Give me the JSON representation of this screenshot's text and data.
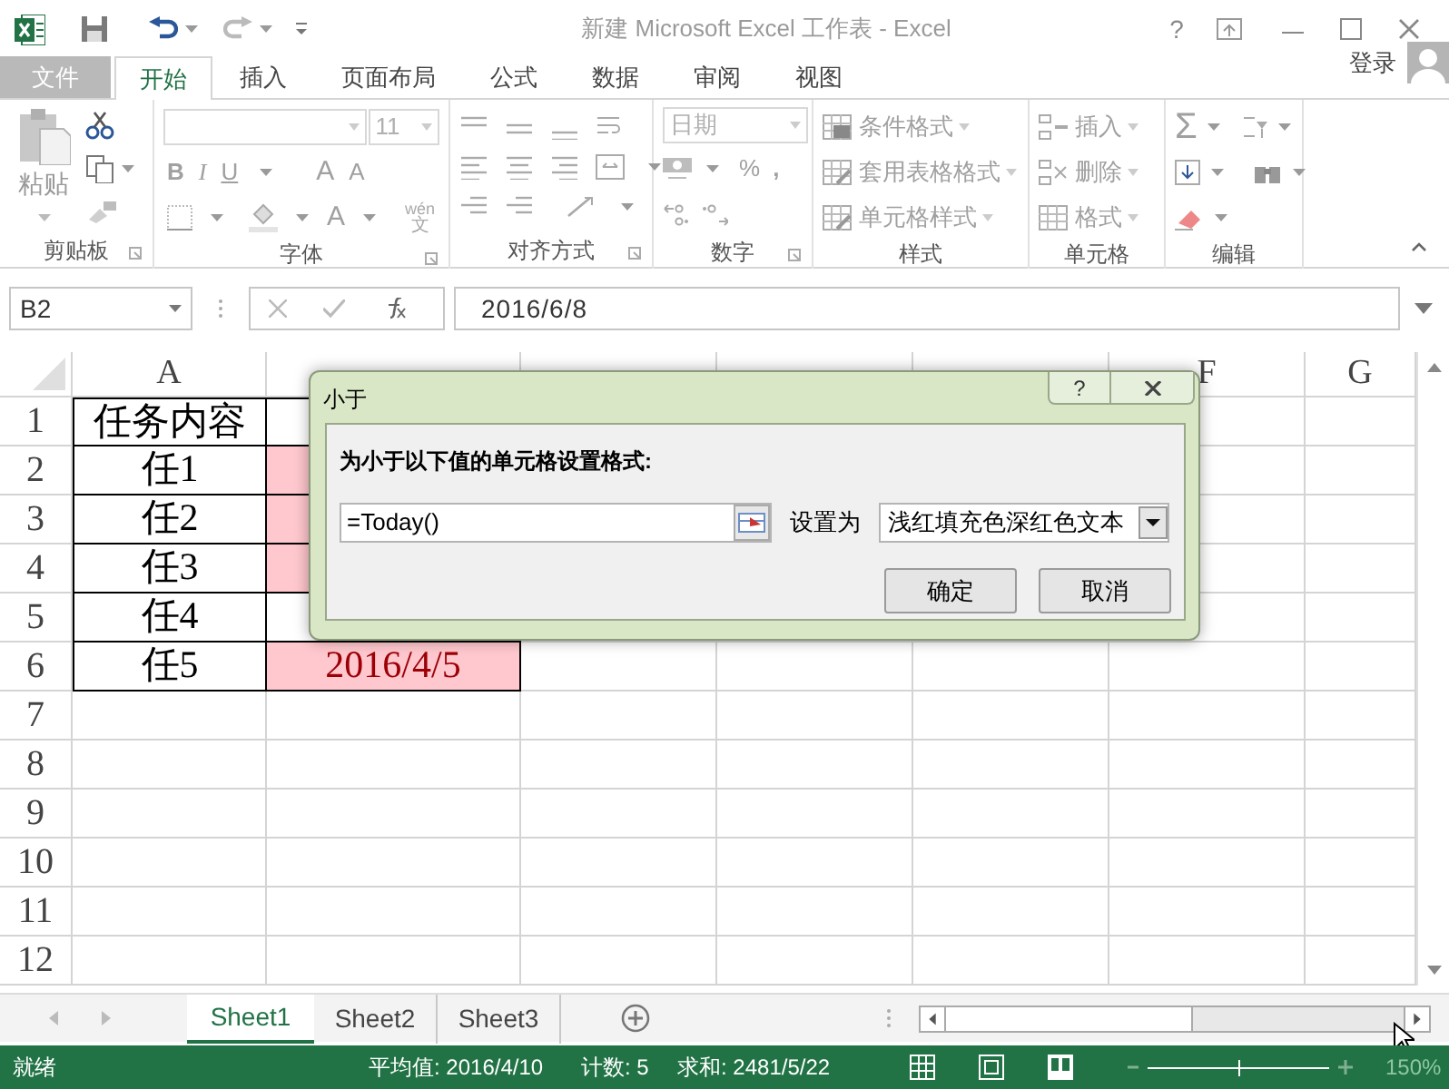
{
  "title_bar": {
    "title": "新建 Microsoft Excel 工作表 - Excel",
    "help": "?"
  },
  "ribbon_tabs": [
    {
      "label": "文件",
      "kind": "file",
      "selected": false
    },
    {
      "label": "开始",
      "kind": "tab",
      "selected": true
    },
    {
      "label": "插入",
      "kind": "tab",
      "selected": false
    },
    {
      "label": "页面布局",
      "kind": "tab",
      "selected": false
    },
    {
      "label": "公式",
      "kind": "tab",
      "selected": false
    },
    {
      "label": "数据",
      "kind": "tab",
      "selected": false
    },
    {
      "label": "审阅",
      "kind": "tab",
      "selected": false
    },
    {
      "label": "视图",
      "kind": "tab",
      "selected": false
    }
  ],
  "account": {
    "label": "登录"
  },
  "ribbon": {
    "paste": "粘贴",
    "font_size": "11",
    "bold": "B",
    "italic": "I",
    "underline": "U",
    "grow_font": "A",
    "shrink_font": "A",
    "font_color": "A",
    "phonetic_top": "wén",
    "phonetic_bottom": "文",
    "number_format": "日期",
    "percent": "%",
    "comma": ",",
    "conditional_format": "条件格式",
    "table_format": "套用表格格式",
    "cell_styles": "单元格样式",
    "insert": "插入",
    "delete": "删除",
    "format": "格式",
    "autosum": "Σ",
    "groups": [
      "剪贴板",
      "字体",
      "对齐方式",
      "数字",
      "样式",
      "单元格",
      "编辑"
    ]
  },
  "formula_bar": {
    "name_box": "B2",
    "formula": "2016/6/8"
  },
  "columns": [
    {
      "label": "A"
    },
    {},
    {},
    {},
    {},
    {
      "label": "F"
    },
    {
      "label": "G"
    }
  ],
  "rows": [
    {
      "header": "1",
      "cells": [
        {
          "text": "任务内容",
          "highlight": false
        },
        {
          "highlight": false
        }
      ]
    },
    {
      "header": "2",
      "cells": [
        {
          "text": "任1",
          "highlight": false
        },
        {
          "highlight": true
        }
      ]
    },
    {
      "header": "3",
      "cells": [
        {
          "text": "任2",
          "highlight": false
        },
        {
          "highlight": true
        }
      ]
    },
    {
      "header": "4",
      "cells": [
        {
          "text": "任3",
          "highlight": false
        },
        {
          "highlight": true
        }
      ]
    },
    {
      "header": "5",
      "cells": [
        {
          "text": "任4",
          "highlight": false
        },
        {
          "highlight": false
        }
      ]
    },
    {
      "header": "6",
      "cells": [
        {
          "text": "任5",
          "highlight": false
        },
        {
          "text": "2016/4/5",
          "highlight": true
        }
      ]
    },
    {
      "header": "7"
    },
    {
      "header": "8"
    },
    {
      "header": "9"
    },
    {
      "header": "10"
    },
    {
      "header": "11"
    },
    {
      "header": "12"
    }
  ],
  "dialog": {
    "title": "小于",
    "help": "?",
    "prompt": "为小于以下值的单元格设置格式:",
    "value": "=Today()",
    "format_label": "设置为",
    "format_value": "浅红填充色深红色文本",
    "buttons": [
      "确定",
      "取消"
    ]
  },
  "sheet_tabs": [
    {
      "label": "Sheet1",
      "selected": true
    },
    {
      "label": "Sheet2",
      "selected": false
    },
    {
      "label": "Sheet3",
      "selected": false
    }
  ],
  "status_bar": {
    "state": "就绪",
    "average": "平均值: 2016/4/10",
    "count": "计数: 5",
    "sum": "求和: 2481/5/22",
    "zoom": "150%",
    "zoom_slider": {
      "level": 0.5
    }
  }
}
